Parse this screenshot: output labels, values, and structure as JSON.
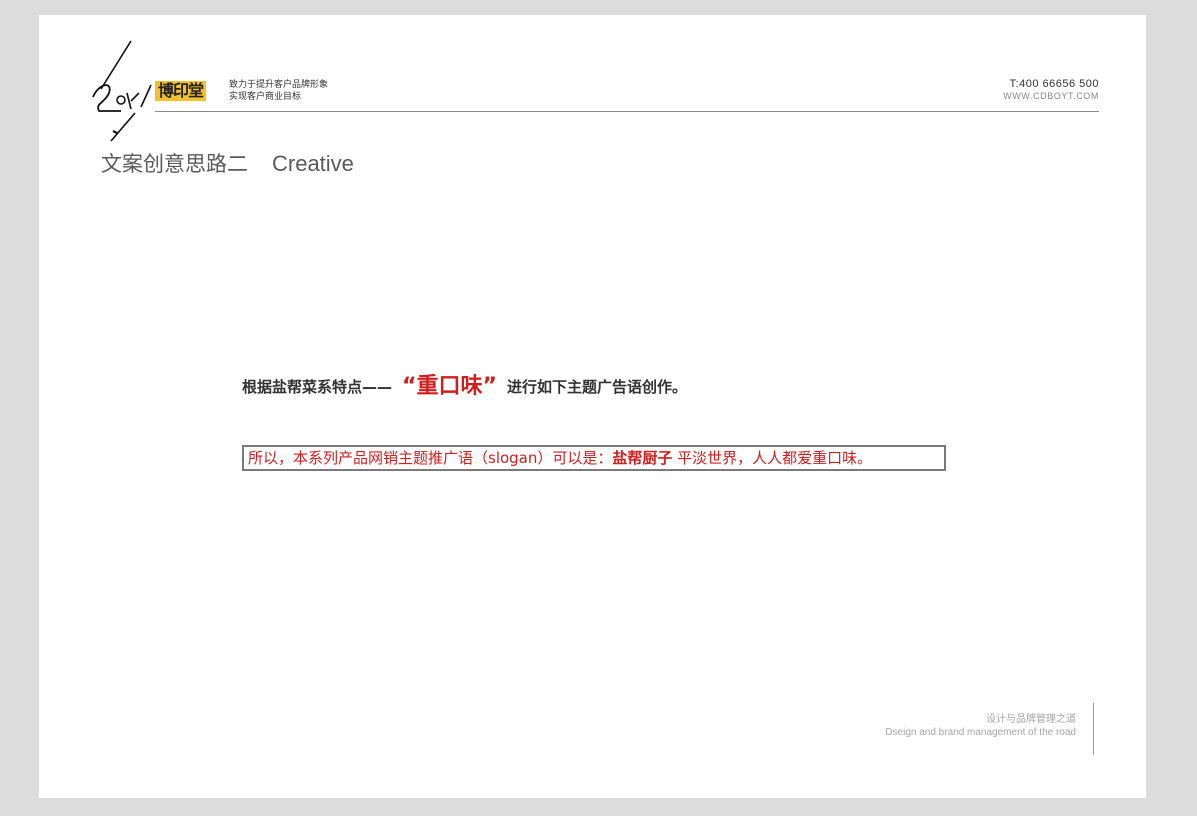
{
  "header": {
    "brand_cn": "博印堂",
    "slogan_line1": "致力于提升客户品牌形象",
    "slogan_line2": "实现客户商业目标",
    "phone": "T:400 66656 500",
    "website": "WWW.CDBOYT.COM"
  },
  "title": {
    "cn": "文案创意思路二",
    "en": "Creative"
  },
  "body": {
    "line1_prefix": "根据盐帮菜系特点——",
    "line1_emphasis": "“重口味”",
    "line1_suffix": "进行如下主题广告语创作。",
    "box_prefix": "所以，本系列产品网销主题推广语（slogan）可以是：",
    "box_brand": "盐帮厨子",
    "box_suffix": " 平淡世界，人人都爱重口味。"
  },
  "footer": {
    "cn": "设计与品牌管理之道",
    "en": "Dseign and brand management of the road"
  },
  "colors": {
    "accent_red": "#d01f1f",
    "brand_yellow": "#f2c12e",
    "background": "#dcdcdc"
  }
}
